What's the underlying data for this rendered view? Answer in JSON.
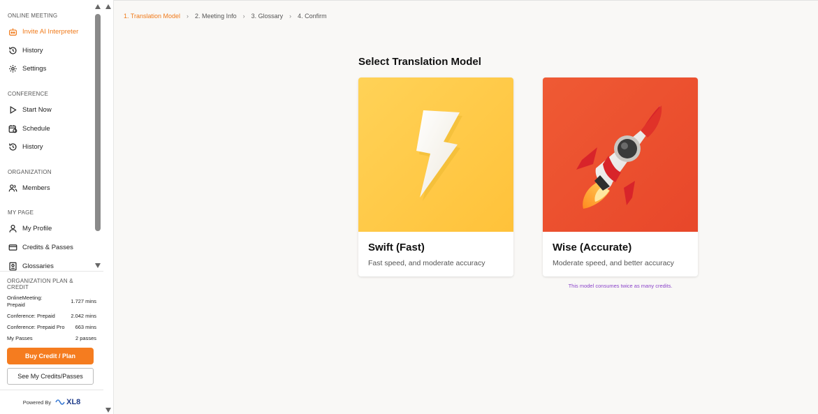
{
  "sidebar": {
    "sections": [
      {
        "label": "ONLINE MEETING",
        "items": [
          {
            "label": "Invite AI Interpreter",
            "icon": "robot-icon",
            "active": true
          },
          {
            "label": "History",
            "icon": "history-icon"
          },
          {
            "label": "Settings",
            "icon": "gear-icon"
          }
        ]
      },
      {
        "label": "CONFERENCE",
        "items": [
          {
            "label": "Start Now",
            "icon": "play-icon"
          },
          {
            "label": "Schedule",
            "icon": "calendar-clock-icon"
          },
          {
            "label": "History",
            "icon": "history-icon"
          }
        ]
      },
      {
        "label": "ORGANIZATION",
        "items": [
          {
            "label": "Members",
            "icon": "users-icon"
          }
        ]
      },
      {
        "label": "MY PAGE",
        "items": [
          {
            "label": "My Profile",
            "icon": "user-icon"
          },
          {
            "label": "Credits & Passes",
            "icon": "credit-card-icon"
          },
          {
            "label": "Glossaries",
            "icon": "book-icon"
          }
        ]
      }
    ],
    "plan": {
      "title": "ORGANIZATION PLAN & CREDIT",
      "rows": [
        {
          "k": "OnlineMeeting: Prepaid",
          "v": "1.727 mins"
        },
        {
          "k": "Conference: Prepaid",
          "v": "2.042 mins"
        },
        {
          "k": "Conference: Prepaid Pro",
          "v": "663 mins"
        },
        {
          "k": "My Passes",
          "v": "2 passes"
        }
      ],
      "buy_label": "Buy Credit / Plan",
      "see_label": "See My Credits/Passes"
    },
    "powered_by": "Powered By",
    "brand": "XL8"
  },
  "steps": [
    "1. Translation Model",
    "2. Meeting Info",
    "3. Glossary",
    "4. Confirm"
  ],
  "main": {
    "heading": "Select Translation Model",
    "cards": [
      {
        "title": "Swift (Fast)",
        "desc": "Fast speed, and moderate accuracy",
        "image": "lightning-icon"
      },
      {
        "title": "Wise (Accurate)",
        "desc": "Moderate speed, and better accuracy",
        "image": "rocket-icon"
      }
    ],
    "note": "This model consumes twice as many credits."
  },
  "colors": {
    "accent": "#f07a1a",
    "button": "#f57c1f",
    "note": "#8b44c9"
  }
}
